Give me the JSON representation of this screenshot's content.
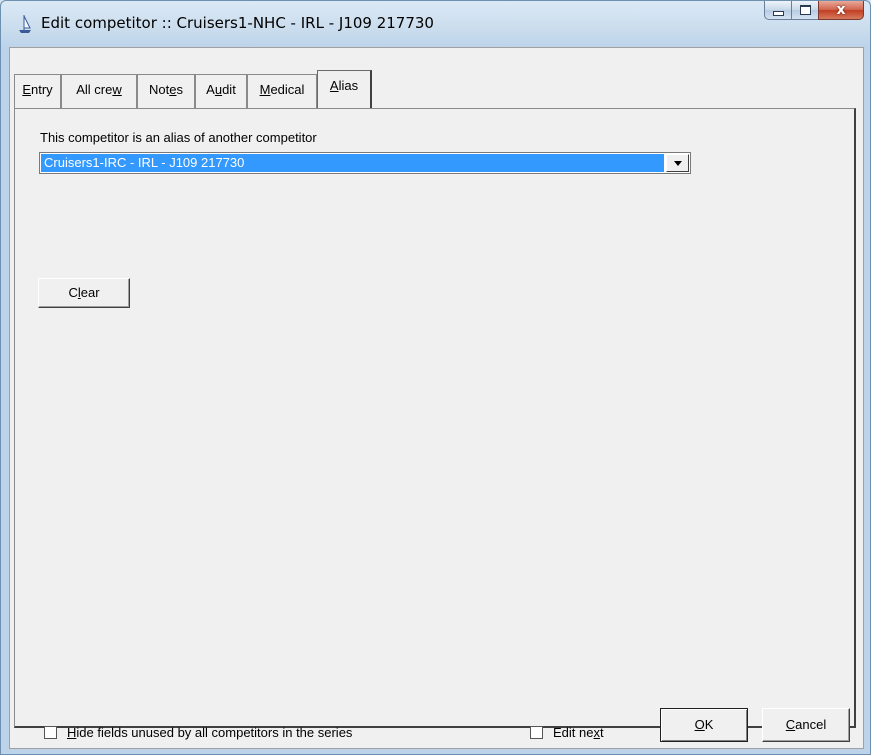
{
  "window": {
    "title": "Edit competitor :: Cruisers1-NHC - IRL - J109 217730",
    "close_glyph": "x"
  },
  "tabs": [
    {
      "label": "Entry"
    },
    {
      "label": "All crew"
    },
    {
      "label": "Notes"
    },
    {
      "label": "Audit"
    },
    {
      "label": "Medical"
    },
    {
      "label": "Alias",
      "active": true
    }
  ],
  "alias": {
    "label": "This competitor is an alias of another competitor",
    "selected": "Cruisers1-IRC - IRL - J109 217730",
    "clear_label": "Clear"
  },
  "footer": {
    "hide_fields_label": "Hide fields unused by all competitors in the series",
    "hide_fields_checked": false,
    "edit_next_label": "Edit next",
    "edit_next_checked": false,
    "ok_label": "OK",
    "cancel_label": "Cancel"
  },
  "colors": {
    "selection": "#3399ff",
    "dialog_bg": "#f0f0f0",
    "close_button": "#c23d22"
  }
}
